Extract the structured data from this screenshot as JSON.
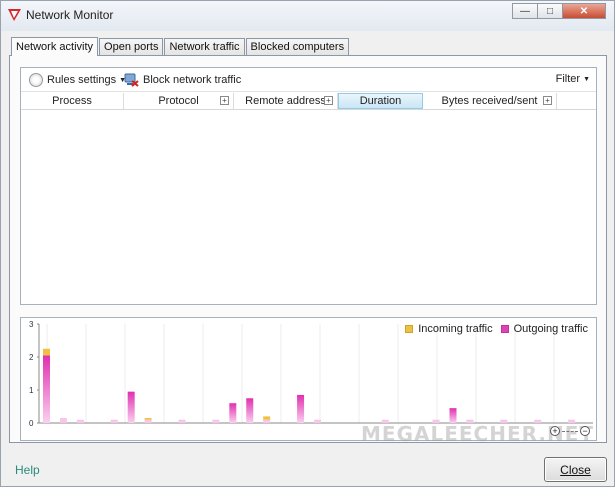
{
  "window": {
    "title": "Network Monitor",
    "controls": [
      "minimize-icon",
      "maximize-icon",
      "close-icon"
    ]
  },
  "tabs": [
    {
      "label": "Network activity",
      "active": true
    },
    {
      "label": "Open ports",
      "active": false
    },
    {
      "label": "Network traffic",
      "active": false
    },
    {
      "label": "Blocked computers",
      "active": false
    }
  ],
  "toolbar": {
    "rules_label": "Rules settings",
    "block_label": "Block network traffic",
    "filter_label": "Filter"
  },
  "columns": [
    {
      "label": "Process",
      "sorted": false
    },
    {
      "label": "Protocol",
      "sorted": false
    },
    {
      "label": "Remote address",
      "sorted": false
    },
    {
      "label": "Duration",
      "sorted": true
    },
    {
      "label": "Bytes received/sent",
      "sorted": false
    }
  ],
  "chart_data": {
    "type": "bar",
    "legend": [
      {
        "name": "Incoming traffic",
        "color": "#f0c040"
      },
      {
        "name": "Outgoing traffic",
        "color": "#e040b8"
      }
    ],
    "legend_position": "top-right",
    "y_ticks": [
      "0",
      "1",
      "2",
      "3"
    ],
    "ylim": [
      0,
      3
    ],
    "grid": true,
    "series": [
      {
        "name": "Incoming traffic",
        "values": [
          0.2,
          0,
          0,
          0,
          0,
          0,
          0.05,
          0,
          0,
          0,
          0,
          0,
          0,
          0.1,
          0,
          0,
          0,
          0,
          0,
          0,
          0,
          0,
          0,
          0,
          0,
          0,
          0,
          0,
          0,
          0,
          0,
          0
        ]
      },
      {
        "name": "Outgoing traffic",
        "values": [
          2.05,
          0.15,
          0.1,
          0,
          0.1,
          0.95,
          0.1,
          0,
          0.1,
          0,
          0.1,
          0.6,
          0.75,
          0.1,
          0,
          0.85,
          0.1,
          0,
          0,
          0,
          0.1,
          0,
          0,
          0.1,
          0.45,
          0.1,
          0,
          0.1,
          0,
          0.1,
          0,
          0.1
        ]
      }
    ]
  },
  "watermark": "MEGALEECHER.NET",
  "footer": {
    "help_label": "Help",
    "close_label": "Close"
  }
}
